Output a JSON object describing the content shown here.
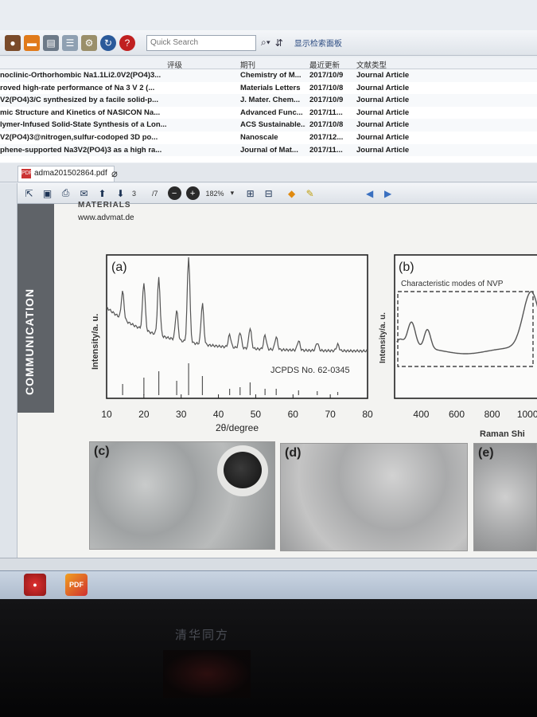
{
  "toolbar": {
    "quick_search_placeholder": "Quick Search",
    "show_panel_label": "显示检索面板"
  },
  "reference_table": {
    "columns": [
      "评级",
      "期刊",
      "最近更新",
      "文献类型"
    ],
    "rows": [
      {
        "title": "noclinic-Orthorhombic Na1.1Li2.0V2(PO4)3...",
        "journal": "Chemistry of M...",
        "date": "2017/10/9",
        "type": "Journal Article"
      },
      {
        "title": "roved high-rate performance of Na 3 V 2 (...",
        "journal": "Materials Letters",
        "date": "2017/10/8",
        "type": "Journal Article"
      },
      {
        "title": "V2(PO4)3/C synthesized by a facile solid-p...",
        "journal": "J. Mater. Chem...",
        "date": "2017/10/9",
        "type": "Journal Article"
      },
      {
        "title": "mic Structure and Kinetics of NASICON Na...",
        "journal": "Advanced Func...",
        "date": "2017/11...",
        "type": "Journal Article"
      },
      {
        "title": "lymer-Infused Solid-State Synthesis of a Lon...",
        "journal": "ACS Sustainable...",
        "date": "2017/10/8",
        "type": "Journal Article"
      },
      {
        "title": "V2(PO4)3@nitrogen,sulfur-codoped 3D po...",
        "journal": "Nanoscale",
        "date": "2017/12...",
        "type": "Journal Article"
      },
      {
        "title": "phene-supported Na3V2(PO4)3 as a high ra...",
        "journal": "Journal of Mat...",
        "date": "2017/11...",
        "type": "Journal Article"
      }
    ]
  },
  "pdf_tab": {
    "filename": "adma201502864.pdf",
    "file_icon_text": "PDF"
  },
  "pdf_toolbar": {
    "current_page": "3",
    "total_pages": "/7",
    "zoom": "182%"
  },
  "pdf_page": {
    "section_label": "COMMUNICATION",
    "header_fragment": "MATERIALS",
    "website": "www.advmat.de",
    "panel_a_label": "(a)",
    "panel_b_label": "(b)",
    "panel_c_label": "(c)",
    "panel_d_label": "(d)",
    "panel_e_label": "(e)",
    "panel_b_annotation": "Characteristic modes of NVP",
    "panel_b_xlabel_visible": "Raman Shi",
    "panel_b_ylabel": "Intensity/a. u."
  },
  "chart_data": [
    {
      "type": "line",
      "panel": "(a)",
      "xlabel": "2θ/degree",
      "ylabel": "Intensity/a. u.",
      "xlim": [
        10,
        80
      ],
      "xticks": [
        10,
        20,
        30,
        40,
        50,
        60,
        70,
        80
      ],
      "annotation": "JCPDS No. 62-0345",
      "peaks_2theta": [
        14.3,
        20.0,
        24.0,
        28.8,
        32.0,
        35.7,
        43.0,
        45.8,
        48.5,
        52.5,
        55.5,
        61.5,
        66.5,
        72.0
      ]
    },
    {
      "type": "line",
      "panel": "(b)",
      "xlabel": "Raman Shi",
      "ylabel": "Intensity/a. u.",
      "xticks": [
        400,
        600,
        800,
        1000
      ]
    }
  ],
  "taskbar": {
    "pdf_label": "PDF"
  },
  "bezel": {
    "brand": "清华同方"
  }
}
